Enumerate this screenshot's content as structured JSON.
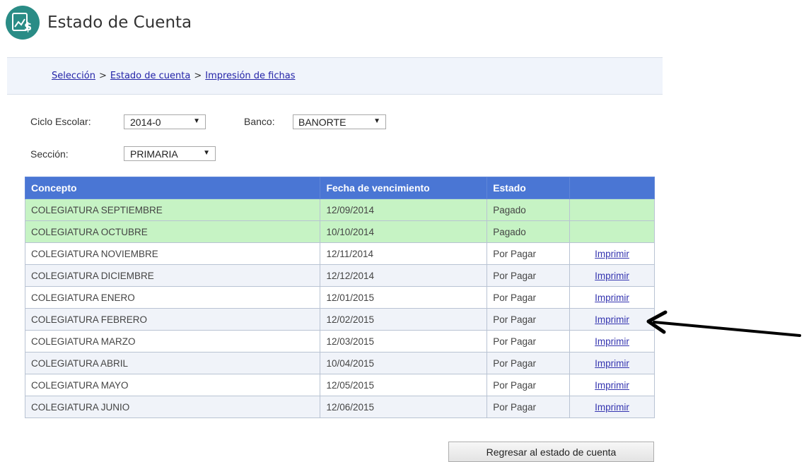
{
  "header": {
    "title": "Estado de Cuenta",
    "logo_icon": "chart-dollar-icon"
  },
  "breadcrumb": {
    "items": [
      "Selección",
      "Estado de cuenta",
      "Impresión de fichas"
    ],
    "separator": ">"
  },
  "filters": {
    "ciclo_label": "Ciclo Escolar:",
    "ciclo_value": "2014-0",
    "banco_label": "Banco:",
    "banco_value": "BANORTE",
    "seccion_label": "Sección:",
    "seccion_value": "PRIMARIA",
    "dropdown_arrow": "▼"
  },
  "table": {
    "headers": [
      "Concepto",
      "Fecha de vencimiento",
      "Estado",
      ""
    ],
    "rows": [
      {
        "concepto": "COLEGIATURA SEPTIEMBRE",
        "fecha": "12/09/2014",
        "estado": "Pagado",
        "accion": ""
      },
      {
        "concepto": "COLEGIATURA OCTUBRE",
        "fecha": "10/10/2014",
        "estado": "Pagado",
        "accion": ""
      },
      {
        "concepto": "COLEGIATURA NOVIEMBRE",
        "fecha": "12/11/2014",
        "estado": "Por Pagar",
        "accion": "Imprimir"
      },
      {
        "concepto": "COLEGIATURA DICIEMBRE",
        "fecha": "12/12/2014",
        "estado": "Por Pagar",
        "accion": "Imprimir"
      },
      {
        "concepto": "COLEGIATURA ENERO",
        "fecha": "12/01/2015",
        "estado": "Por Pagar",
        "accion": "Imprimir"
      },
      {
        "concepto": "COLEGIATURA FEBRERO",
        "fecha": "12/02/2015",
        "estado": "Por Pagar",
        "accion": "Imprimir"
      },
      {
        "concepto": "COLEGIATURA MARZO",
        "fecha": "12/03/2015",
        "estado": "Por Pagar",
        "accion": "Imprimir"
      },
      {
        "concepto": "COLEGIATURA ABRIL",
        "fecha": "10/04/2015",
        "estado": "Por Pagar",
        "accion": "Imprimir"
      },
      {
        "concepto": "COLEGIATURA MAYO",
        "fecha": "12/05/2015",
        "estado": "Por Pagar",
        "accion": "Imprimir"
      },
      {
        "concepto": "COLEGIATURA JUNIO",
        "fecha": "12/06/2015",
        "estado": "Por Pagar",
        "accion": "Imprimir"
      }
    ]
  },
  "annotation": {
    "icon": "arrow-left-icon",
    "target_row": "COLEGIATURA FEBRERO"
  },
  "actions": {
    "back_label": "Regresar al estado de cuenta"
  },
  "colors": {
    "header_bg": "#4a76d4",
    "paid_row": "#c6f3c4",
    "link": "#3434b0",
    "logo": "#2a8c86"
  }
}
